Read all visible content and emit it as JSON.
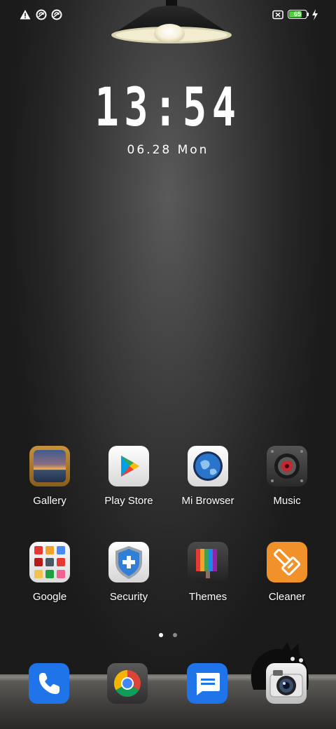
{
  "status": {
    "icons": [
      "warning-icon",
      "sync-icon",
      "sync-icon",
      "no-sim-icon",
      "battery-icon",
      "charging-bolt-icon"
    ],
    "battery_level": "65"
  },
  "lockclock": {
    "time": "13:54",
    "date": "06.28 Mon"
  },
  "apps_row1": [
    {
      "label": "Gallery",
      "icon": "gallery-icon"
    },
    {
      "label": "Play Store",
      "icon": "play-store-icon"
    },
    {
      "label": "Mi Browser",
      "icon": "mi-browser-icon"
    },
    {
      "label": "Music",
      "icon": "music-icon"
    }
  ],
  "apps_row2": [
    {
      "label": "Google",
      "icon": "google-folder-icon"
    },
    {
      "label": "Security",
      "icon": "security-icon"
    },
    {
      "label": "Themes",
      "icon": "themes-icon"
    },
    {
      "label": "Cleaner",
      "icon": "cleaner-icon"
    }
  ],
  "dock": [
    {
      "icon": "phone-icon"
    },
    {
      "icon": "chrome-icon"
    },
    {
      "icon": "messages-icon"
    },
    {
      "icon": "camera-icon"
    }
  ],
  "pager": {
    "pages": 2,
    "active": 1
  },
  "colors": {
    "accent_blue": "#1e74e8",
    "cleaner_orange": "#f0912a",
    "battery_green": "#4cd137"
  }
}
